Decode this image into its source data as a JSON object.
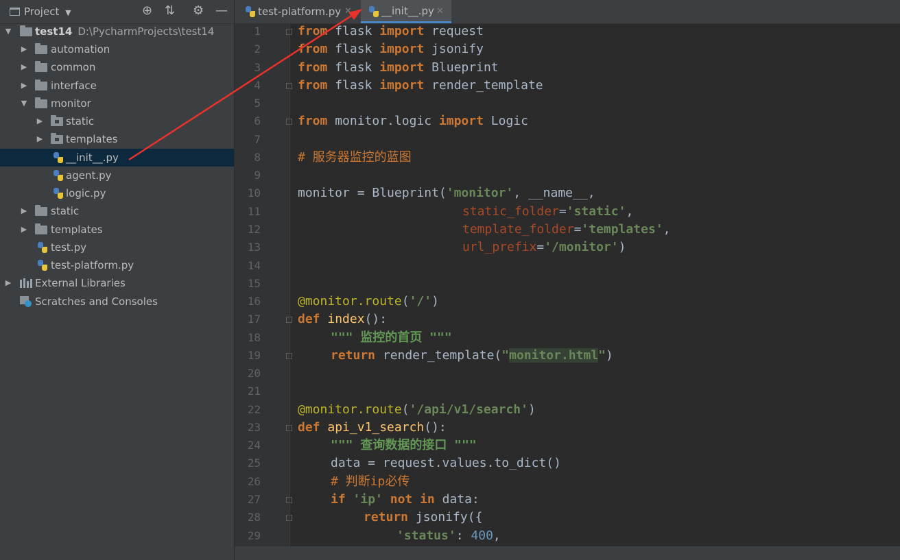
{
  "project_panel": {
    "title": "Project",
    "header_icons": [
      "crosshair-icon",
      "collapse-icon",
      "gear-icon",
      "minimize-icon"
    ],
    "tree": [
      {
        "label": "test14",
        "path": "D:\\PycharmProjects\\test14",
        "type": "folder",
        "level": 0,
        "expanded": true
      },
      {
        "label": "automation",
        "type": "folder",
        "level": 1,
        "expanded": false
      },
      {
        "label": "common",
        "type": "folder",
        "level": 1,
        "expanded": false
      },
      {
        "label": "interface",
        "type": "folder",
        "level": 1,
        "expanded": false
      },
      {
        "label": "monitor",
        "type": "folder",
        "level": 1,
        "expanded": true
      },
      {
        "label": "static",
        "type": "folder",
        "level": 2,
        "expanded": false
      },
      {
        "label": "templates",
        "type": "folder",
        "level": 2,
        "expanded": false
      },
      {
        "label": "__init__.py",
        "type": "python",
        "level": 2,
        "selected": true
      },
      {
        "label": "agent.py",
        "type": "python",
        "level": 2
      },
      {
        "label": "logic.py",
        "type": "python",
        "level": 2
      },
      {
        "label": "static",
        "type": "folder",
        "level": 1,
        "expanded": false
      },
      {
        "label": "templates",
        "type": "folder",
        "level": 1,
        "expanded": false
      },
      {
        "label": "test.py",
        "type": "python",
        "level": 1
      },
      {
        "label": "test-platform.py",
        "type": "python",
        "level": 1
      },
      {
        "label": "External Libraries",
        "type": "library",
        "level": 0,
        "expanded": false
      },
      {
        "label": "Scratches and Consoles",
        "type": "scratch",
        "level": 0
      }
    ]
  },
  "editor": {
    "tabs": [
      {
        "label": "test-platform.py",
        "active": false
      },
      {
        "label": "__init__.py",
        "active": true
      }
    ],
    "line_numbers": [
      "1",
      "2",
      "3",
      "4",
      "5",
      "6",
      "7",
      "8",
      "9",
      "10",
      "11",
      "12",
      "13",
      "14",
      "15",
      "16",
      "17",
      "18",
      "19",
      "20",
      "21",
      "22",
      "23",
      "24",
      "25",
      "26",
      "27",
      "28",
      "29"
    ],
    "code": {
      "kw_from": "from",
      "kw_import": "import",
      "kw_def": "def",
      "kw_return": "return",
      "kw_if": "if",
      "kw_not": "not",
      "kw_in": "in",
      "flask": " flask ",
      "request": " request",
      "jsonify": " jsonify",
      "Blueprint": " Blueprint",
      "render_template": " render_template",
      "monitor_logic": " monitor.logic ",
      "Logic": " Logic",
      "comment_blueprint": "# 服务器监控的蓝图",
      "monitor_assign": "monitor = Blueprint(",
      "str_monitor": "'monitor'",
      "comma_name": ", ",
      "name_dunder": "__name__",
      "comma": ",",
      "static_folder": "static_folder",
      "eq": "=",
      "str_static": "'static'",
      "template_folder": "template_folder",
      "str_templates": "'templates'",
      "url_prefix": "url_prefix",
      "str_prefix": "'/monitor'",
      "close_paren": ")",
      "dec_route": "@monitor.route",
      "open_paren": "(",
      "str_root": "'/'",
      "fn_index": "index",
      "parens_colon": "():",
      "doc_index": "\"\"\" 监控的首页 \"\"\"",
      "render_call": " render_template(",
      "str_html_q": "\"",
      "str_html": "monitor.html",
      "str_search": "'/api/v1/search'",
      "fn_search": "api_v1_search",
      "doc_search": "\"\"\" 查询数据的接口 \"\"\"",
      "data_assign": "data = request.values.to_dict()",
      "comment_ip": "# 判断ip必传",
      "str_ip": "'ip'",
      "data_colon": " data:",
      "jsonify_open": " jsonify({",
      "str_status": "'status'",
      "colon_sp": ": ",
      "num_400": "400",
      "space": " "
    }
  }
}
